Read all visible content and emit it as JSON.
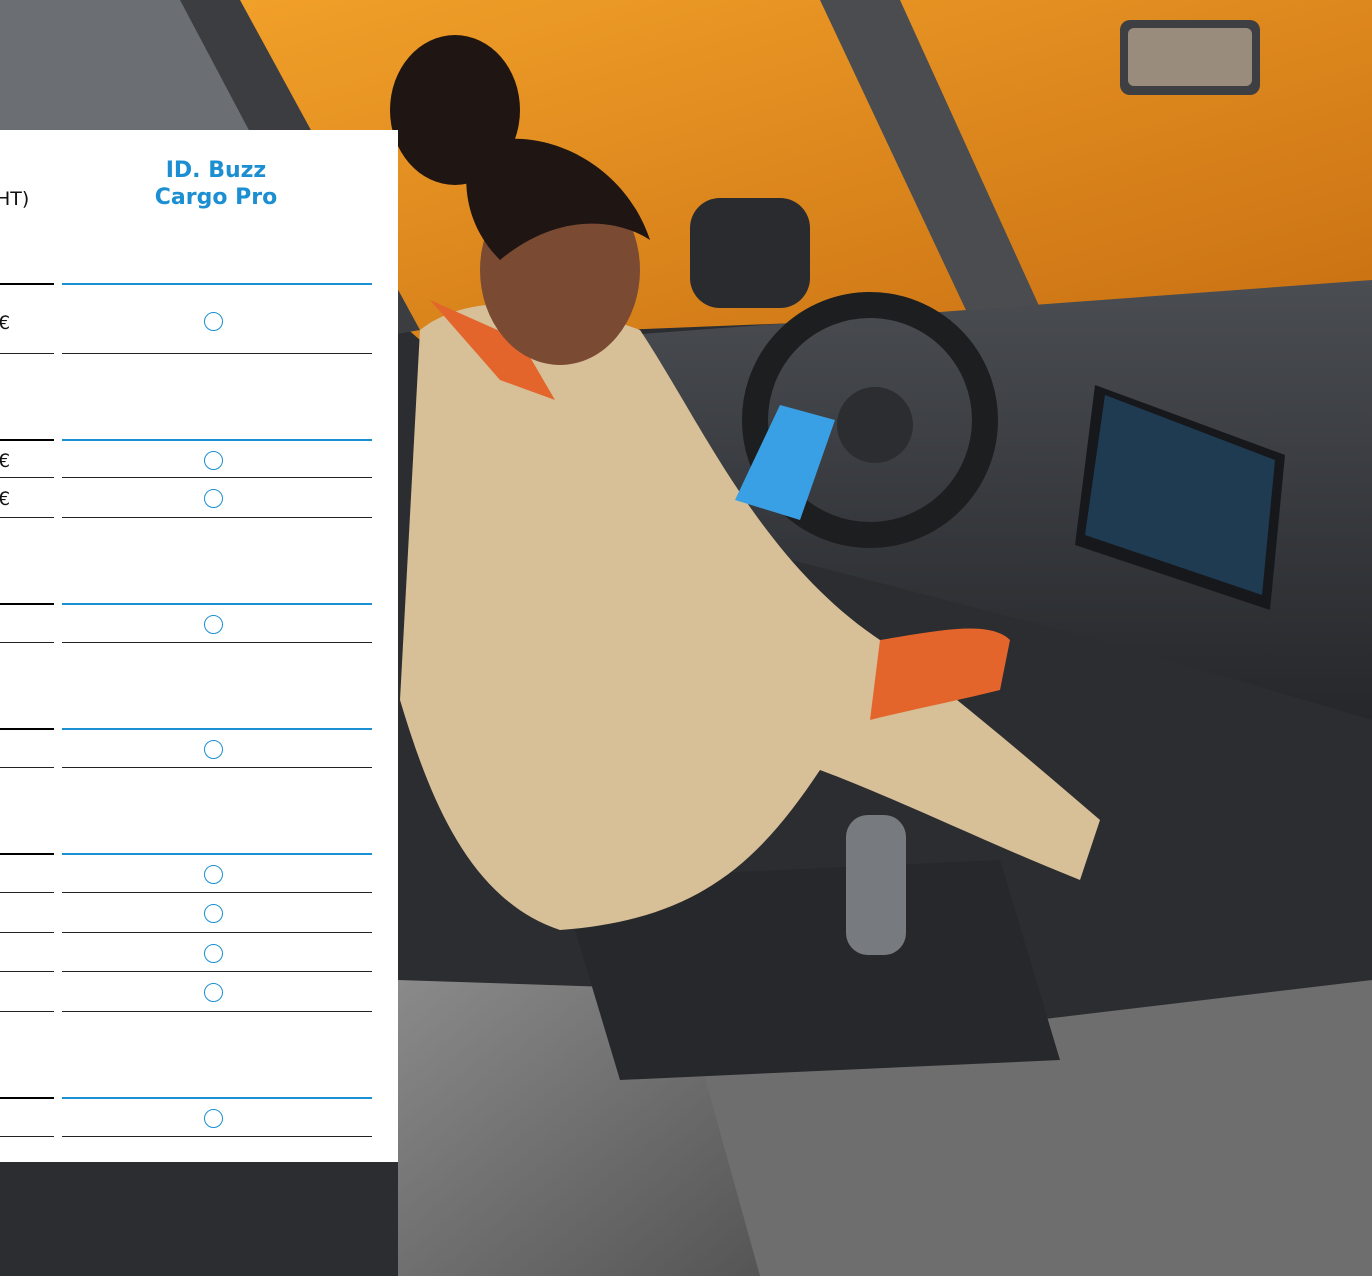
{
  "table": {
    "column_title_line1": "ID. Buzz",
    "column_title_line2": "Cargo Pro",
    "header_suffix": "HT)",
    "groups": [
      {
        "rows": [
          {
            "price": "€",
            "option": "○"
          }
        ]
      },
      {
        "rows": [
          {
            "price": "€",
            "option": "○"
          },
          {
            "price": "€",
            "option": "○"
          }
        ]
      },
      {
        "rows": [
          {
            "price": "€",
            "option": "○"
          }
        ]
      },
      {
        "rows": [
          {
            "price": "€",
            "option": "○"
          }
        ]
      },
      {
        "rows": [
          {
            "price": "€",
            "option": "○"
          },
          {
            "price": "€",
            "option": "○"
          },
          {
            "price": "",
            "option": "○"
          },
          {
            "price": "",
            "option": "○"
          }
        ]
      },
      {
        "rows": [
          {
            "price": "€",
            "option": "○"
          }
        ]
      }
    ]
  },
  "colors": {
    "accent": "#1b8fd1",
    "panel": "#ffffff",
    "wall": "#e9900f",
    "interior": "#3a3a3c"
  }
}
